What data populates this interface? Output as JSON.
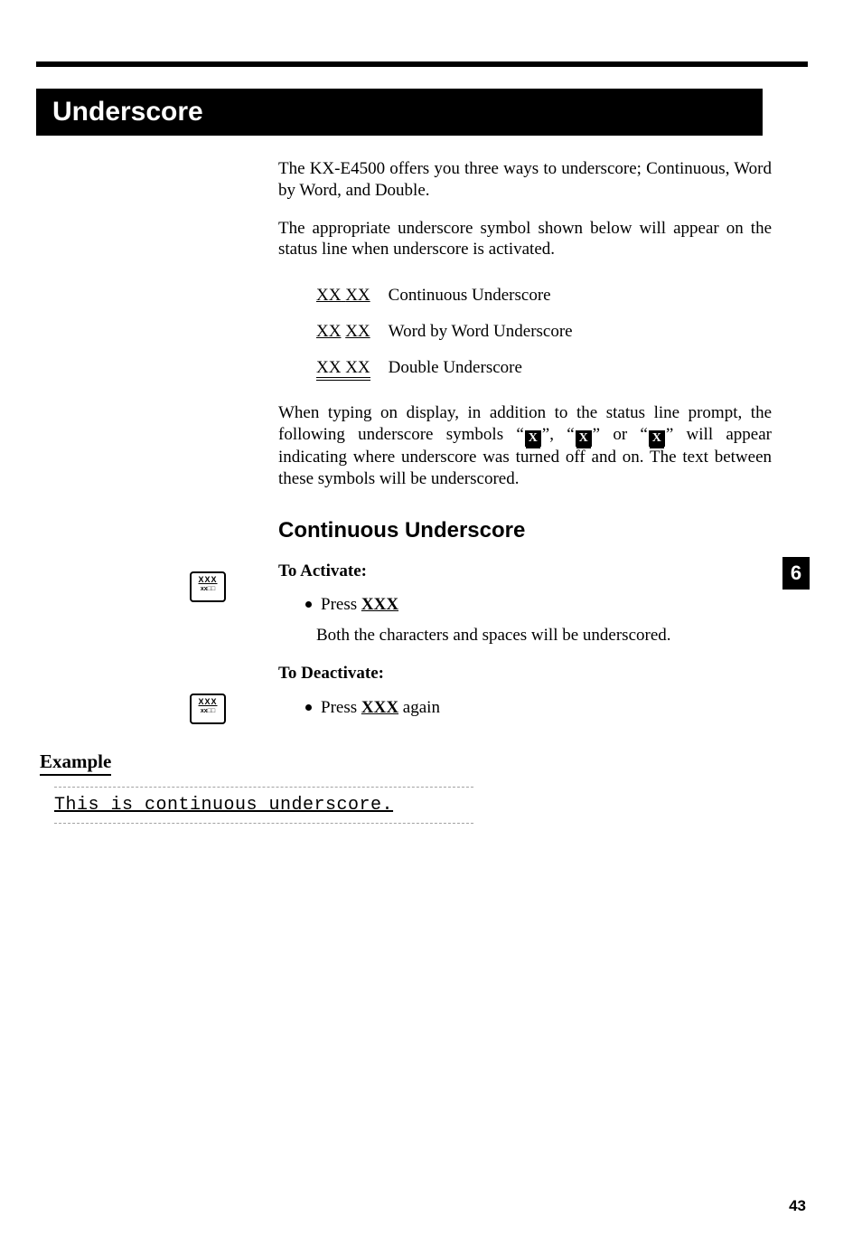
{
  "title": "Underscore",
  "intro1": "The KX-E4500 offers you three ways to underscore; Continuous, Word by Word, and Double.",
  "intro2": "The appropriate underscore symbol shown below will appear on the status line when underscore is activated.",
  "symbols": [
    {
      "glyph_a": "XX",
      "glyph_b": "XX",
      "label": "Continuous Underscore"
    },
    {
      "glyph_a": "XX",
      "glyph_b": "XX",
      "label": "Word by Word Underscore"
    },
    {
      "glyph_a": "XX",
      "glyph_b": "XX",
      "label": "Double Underscore"
    }
  ],
  "para3_pre": "When typing on display, in addition to the status line prompt, the following underscore symbols “",
  "para3_mid1": "”, “",
  "para3_mid2": "” or “",
  "para3_post": "” will appear indicating where underscore was turned off and on. The text between these symbols will be underscored.",
  "xbox_char": "X",
  "section2": "Continuous Underscore",
  "activate_h": "To Activate:",
  "press_word": "Press ",
  "press_key": "XXX",
  "activate_note": "Both the characters and spaces will be underscored.",
  "deactivate_h": "To Deactivate:",
  "deactivate_tail": " again",
  "key_icon_l1": "XXX",
  "key_icon_l2": "xx□□",
  "tab_num": "6",
  "example_h": "Example",
  "example_text": "This is continuous underscore.",
  "page_num": "43"
}
